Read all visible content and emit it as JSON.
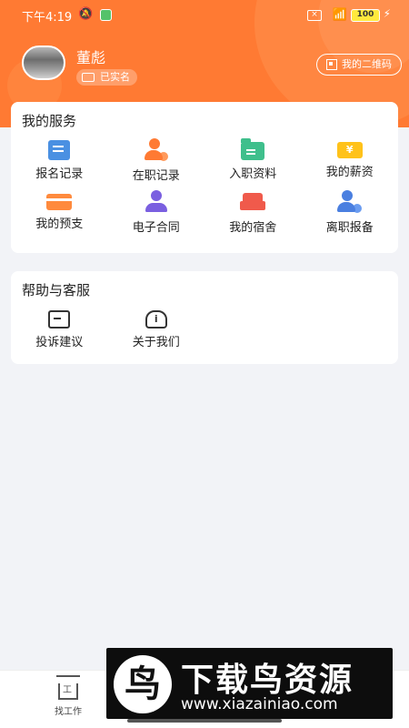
{
  "status_bar": {
    "time": "下午4:19",
    "battery": "100"
  },
  "profile": {
    "name": "董彪",
    "verified_label": "已实名",
    "qrcode_label": "我的二维码"
  },
  "services": {
    "title": "我的服务",
    "items": [
      {
        "label": "报名记录",
        "icon": "edit-document-icon"
      },
      {
        "label": "在职记录",
        "icon": "person-check-icon"
      },
      {
        "label": "入职资料",
        "icon": "folder-icon"
      },
      {
        "label": "我的薪资",
        "icon": "salary-ticket-icon"
      },
      {
        "label": "我的预支",
        "icon": "card-icon"
      },
      {
        "label": "电子合同",
        "icon": "contract-person-icon"
      },
      {
        "label": "我的宿舍",
        "icon": "bed-icon"
      },
      {
        "label": "离职报备",
        "icon": "person-leave-icon"
      }
    ]
  },
  "help": {
    "title": "帮助与客服",
    "items": [
      {
        "label": "投诉建议",
        "icon": "complaint-icon"
      },
      {
        "label": "关于我们",
        "icon": "about-icon"
      }
    ]
  },
  "tabbar": {
    "job_label": "找工作"
  },
  "watermark": {
    "logo_char": "鸟",
    "title": "下载鸟资源",
    "url": "www.xiazainiao.com"
  },
  "colors": {
    "accent": "#ff7a33",
    "background": "#f2f3f7"
  }
}
